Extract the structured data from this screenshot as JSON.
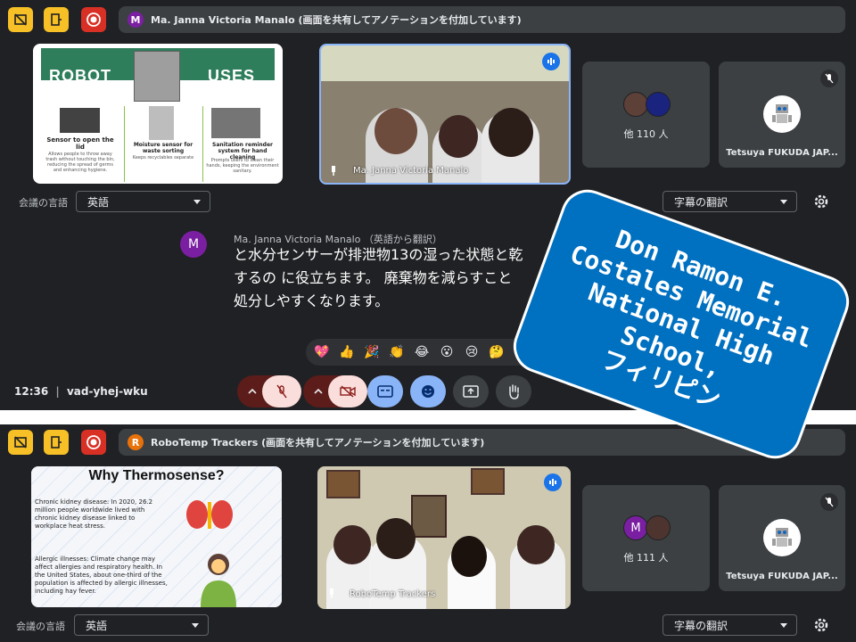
{
  "top": {
    "banner_avatar": "M",
    "banner_avatar_color": "#7b1fa2",
    "banner_text": "Ma. Janna Victoria Manalo (画面を共有してアノテーションを付加しています)",
    "slide": {
      "title_left": "ROBOT",
      "title_right": "USES",
      "col1_head": "Sensor to open the lid",
      "col1_body": "Allows people to throw away trash without touching the bin, reducing the spread of germs and enhancing hygiene.",
      "col2_head": "Moisture sensor for waste sorting",
      "col2_body": "Keeps recyclables separate",
      "col3_head": "Sanitation reminder system for hand cleaning",
      "col3_body": "Prompts users to clean their hands, keeping the environment sanitary."
    },
    "video_name": "Ma. Janna Victoria Manalo",
    "others_label": "他 110 人",
    "tetsuya_label": "Tetsuya FUKUDA JAP...",
    "lang_label": "会議の言語",
    "lang_value": "英語",
    "caption_select": "字幕の翻訳",
    "caption_avatar": "M",
    "caption_speaker": "Ma. Janna Victoria Manalo",
    "caption_note": "（英語から翻訳）",
    "caption_line1": "と水分センサーが排泄物13の湿った状態と乾",
    "caption_line2": "するの に役立ちます。 廃棄物を減らすこと",
    "caption_line3": "処分しやすくなります。",
    "emojis": [
      "💖",
      "👍",
      "🎉",
      "👏",
      "😂",
      "😮",
      "😢",
      "🤔"
    ],
    "time": "12:36",
    "meeting_code": "vad-yhej-wku"
  },
  "bottom": {
    "banner_avatar": "R",
    "banner_avatar_color": "#e8710a",
    "banner_text": "RoboTemp Trackers (画面を共有してアノテーションを付加しています)",
    "slide": {
      "title": "Why Thermosense?",
      "p1": "Chronic kidney disease: In 2020, 26.2 million people worldwide lived with chronic kidney disease linked to workplace heat stress.",
      "p2": "Allergic illnesses: Climate change may affect allergies and respiratory health. In the United States, about one-third of the population is affected by allergic illnesses, including hay fever."
    },
    "video_name": "RoboTemp Trackers",
    "others_avatar": "M",
    "others_label": "他 111 人",
    "tetsuya_label": "Tetsuya FUKUDA JAP...",
    "lang_label": "会議の言語",
    "lang_value": "英語",
    "caption_select": "字幕の翻訳"
  },
  "overlay": {
    "line1": "Don Ramon E.",
    "line2": "Costales Memorial",
    "line3": "National High",
    "line4": "School,",
    "line5": "フィリピン",
    "color": "#0070c0"
  }
}
